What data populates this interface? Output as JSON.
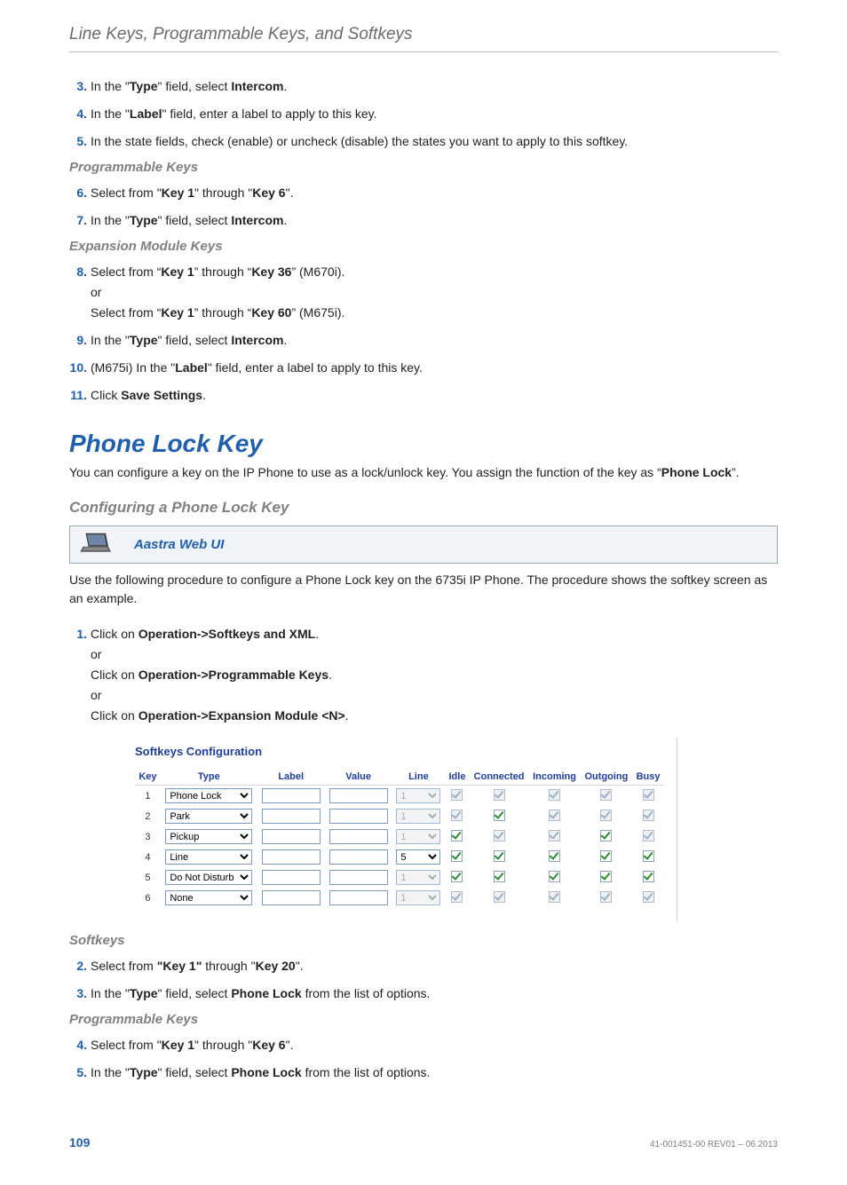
{
  "header": {
    "title": "Line Keys, Programmable Keys, and Softkeys"
  },
  "steps_top": [
    {
      "n": "3.",
      "html": "In the \"<b>Type</b>\" field, select <b>Intercom</b>."
    },
    {
      "n": "4.",
      "html": "In the \"<b>Label</b>\" field, enter a label to apply to this key."
    },
    {
      "n": "5.",
      "html": "In the state fields, check (enable) or uncheck (disable) the states you want to apply to this softkey."
    }
  ],
  "progkeys_heading": "Programmable Keys",
  "steps_prog": [
    {
      "n": "6.",
      "html": "Select from \"<b>Key 1</b>\" through \"<b>Key 6</b>\"."
    },
    {
      "n": "7.",
      "html": "In the \"<b>Type</b>\" field, select <b>Intercom</b>."
    }
  ],
  "expmod_heading": "Expansion Module Keys",
  "steps_exp": [
    {
      "n": "8.",
      "html": "Select from “<b>Key 1</b>” through “<b>Key 36</b>” (M670i).<div class=\"subline\">or</div>Select from “<b>Key 1</b>” through “<b>Key 60</b>” (M675i)."
    },
    {
      "n": "9.",
      "html": "In the \"<b>Type</b>\" field, select <b>Intercom</b>."
    },
    {
      "n": "10.",
      "html": "(M675i) In the \"<b>Label</b>\" field, enter a label to apply to this key."
    },
    {
      "n": "11.",
      "html": "Click <b>Save Settings</b>."
    }
  ],
  "section_title": "Phone Lock Key",
  "section_intro": "You can configure a key on the IP Phone to use as a lock/unlock key. You assign the function of the key as “<b>Phone Lock</b>”.",
  "config_heading": "Configuring a Phone Lock Key",
  "webui_label": "Aastra Web UI",
  "config_intro": "Use the following procedure to configure a Phone Lock key on the 6735i IP Phone. The procedure shows the softkey screen as an example.",
  "steps_cfg1": [
    {
      "n": "1.",
      "html": "Click on <b>Operation-&gt;Softkeys and XML</b>.<div class=\"subline\">or</div>Click on <b>Operation-&gt;Programmable Keys</b>.<div class=\"subline\">or</div>Click on <b>Operation-&gt;Expansion Module &lt;N&gt;</b>."
    }
  ],
  "chart_data": {
    "type": "table",
    "title": "Softkeys Configuration",
    "columns": [
      "Key",
      "Type",
      "Label",
      "Value",
      "Line",
      "Idle",
      "Connected",
      "Incoming",
      "Outgoing",
      "Busy"
    ],
    "rows": [
      {
        "key": "1",
        "type": "Phone Lock",
        "label": "",
        "value": "",
        "line": "1",
        "line_disabled": true,
        "states": {
          "Idle": [
            "checked",
            "grey",
            "disabled"
          ],
          "Connected": [
            "checked",
            "grey",
            "disabled"
          ],
          "Incoming": [
            "checked",
            "grey",
            "disabled"
          ],
          "Outgoing": [
            "checked",
            "grey",
            "disabled"
          ],
          "Busy": [
            "checked",
            "grey",
            "disabled"
          ]
        }
      },
      {
        "key": "2",
        "type": "Park",
        "label": "",
        "value": "",
        "line": "1",
        "line_disabled": true,
        "states": {
          "Idle": [
            "checked",
            "grey",
            "disabled"
          ],
          "Connected": [
            "checked",
            "green"
          ],
          "Incoming": [
            "checked",
            "grey",
            "disabled"
          ],
          "Outgoing": [
            "checked",
            "grey",
            "disabled"
          ],
          "Busy": [
            "checked",
            "grey",
            "disabled"
          ]
        }
      },
      {
        "key": "3",
        "type": "Pickup",
        "label": "",
        "value": "",
        "line": "1",
        "line_disabled": true,
        "states": {
          "Idle": [
            "checked",
            "green"
          ],
          "Connected": [
            "checked",
            "grey",
            "disabled"
          ],
          "Incoming": [
            "checked",
            "grey",
            "disabled"
          ],
          "Outgoing": [
            "checked",
            "green"
          ],
          "Busy": [
            "checked",
            "grey",
            "disabled"
          ]
        }
      },
      {
        "key": "4",
        "type": "Line",
        "label": "",
        "value": "",
        "line": "5",
        "line_disabled": false,
        "states": {
          "Idle": [
            "checked",
            "green"
          ],
          "Connected": [
            "checked",
            "green"
          ],
          "Incoming": [
            "checked",
            "green"
          ],
          "Outgoing": [
            "checked",
            "green"
          ],
          "Busy": [
            "checked",
            "green"
          ]
        }
      },
      {
        "key": "5",
        "type": "Do Not Disturb",
        "label": "",
        "value": "",
        "line": "1",
        "line_disabled": true,
        "states": {
          "Idle": [
            "checked",
            "green"
          ],
          "Connected": [
            "checked",
            "green"
          ],
          "Incoming": [
            "checked",
            "green"
          ],
          "Outgoing": [
            "checked",
            "green"
          ],
          "Busy": [
            "checked",
            "green"
          ]
        }
      },
      {
        "key": "6",
        "type": "None",
        "label": "",
        "value": "",
        "line": "1",
        "line_disabled": true,
        "states": {
          "Idle": [
            "checked",
            "grey",
            "disabled"
          ],
          "Connected": [
            "checked",
            "grey",
            "disabled"
          ],
          "Incoming": [
            "checked",
            "grey",
            "disabled"
          ],
          "Outgoing": [
            "checked",
            "grey",
            "disabled"
          ],
          "Busy": [
            "checked",
            "grey",
            "disabled"
          ]
        }
      }
    ]
  },
  "softkeys_heading": "Softkeys",
  "steps_softkeys": [
    {
      "n": "2.",
      "html": "Select from <b>\"Key 1\"</b> through \"<b>Key 20</b>\"."
    },
    {
      "n": "3.",
      "html": "In the \"<b>Type</b>\" field, select <b>Phone Lock</b> from the list of options."
    }
  ],
  "progkeys2_heading": "Programmable Keys",
  "steps_prog2": [
    {
      "n": "4.",
      "html": "Select from \"<b>Key 1</b>\" through \"<b>Key 6</b>\"."
    },
    {
      "n": "5.",
      "html": "In the \"<b>Type</b>\" field, select <b>Phone Lock</b> from the list of options."
    }
  ],
  "footer": {
    "page": "109",
    "docid": "41-001451-00 REV01 – 06.2013"
  }
}
